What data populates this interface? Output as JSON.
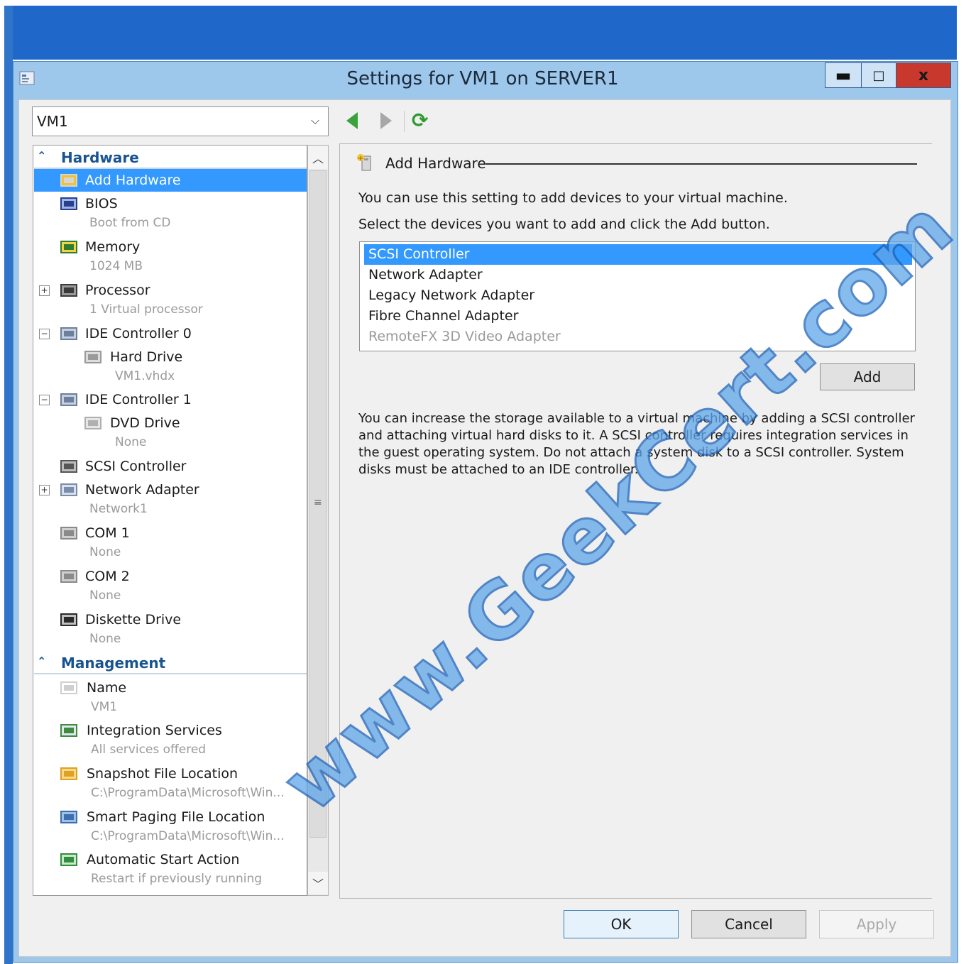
{
  "window": {
    "title": "Settings for VM1 on SERVER1",
    "minimize_glyph": "▬",
    "maximize_glyph": "□",
    "close_glyph": "x"
  },
  "vm_selector": {
    "selected": "VM1"
  },
  "tree": {
    "hardware_section": "Hardware",
    "management_section": "Management",
    "items": [
      {
        "label": "Add Hardware",
        "sub": "",
        "icon": "add-hardware-icon"
      },
      {
        "label": "BIOS",
        "sub": "Boot from CD",
        "icon": "bios-icon"
      },
      {
        "label": "Memory",
        "sub": "1024 MB",
        "icon": "memory-icon"
      },
      {
        "label": "Processor",
        "sub": "1 Virtual processor",
        "icon": "processor-icon"
      },
      {
        "label": "IDE Controller 0",
        "sub": "",
        "icon": "ide-controller-icon"
      },
      {
        "label": "Hard Drive",
        "sub": "VM1.vhdx",
        "icon": "hard-drive-icon"
      },
      {
        "label": "IDE Controller 1",
        "sub": "",
        "icon": "ide-controller-icon"
      },
      {
        "label": "DVD Drive",
        "sub": "None",
        "icon": "dvd-drive-icon"
      },
      {
        "label": "SCSI Controller",
        "sub": "",
        "icon": "scsi-controller-icon"
      },
      {
        "label": "Network Adapter",
        "sub": "Network1",
        "icon": "network-adapter-icon"
      },
      {
        "label": "COM 1",
        "sub": "None",
        "icon": "com-port-icon"
      },
      {
        "label": "COM 2",
        "sub": "None",
        "icon": "com-port-icon"
      },
      {
        "label": "Diskette Drive",
        "sub": "None",
        "icon": "diskette-drive-icon"
      }
    ],
    "mgmt_items": [
      {
        "label": "Name",
        "sub": "VM1",
        "icon": "name-icon"
      },
      {
        "label": "Integration Services",
        "sub": "All services offered",
        "icon": "integration-services-icon"
      },
      {
        "label": "Snapshot File Location",
        "sub": "C:\\ProgramData\\Microsoft\\Win...",
        "icon": "snapshot-icon"
      },
      {
        "label": "Smart Paging File Location",
        "sub": "C:\\ProgramData\\Microsoft\\Win...",
        "icon": "smart-paging-icon"
      },
      {
        "label": "Automatic Start Action",
        "sub": "Restart if previously running",
        "icon": "auto-start-icon"
      }
    ]
  },
  "content": {
    "title": "Add Hardware",
    "description": "You can use this setting to add devices to your virtual machine.",
    "instruction": "Select the devices you want to add and click the Add button.",
    "devices": [
      "SCSI Controller",
      "Network Adapter",
      "Legacy Network Adapter",
      "Fibre Channel Adapter",
      "RemoteFX 3D Video Adapter"
    ],
    "add_label": "Add",
    "info": "You can increase the storage available to a virtual machine by adding a SCSI controller and attaching virtual hard disks to it. A SCSI controller requires integration services in the guest operating system. Do not attach a system disk to a SCSI controller. System disks must be attached to an IDE controller."
  },
  "buttons": {
    "ok": "OK",
    "cancel": "Cancel",
    "apply": "Apply"
  },
  "watermark": "www.GeekCert.com",
  "colors": {
    "selection": "#3399ff",
    "title_band": "#1f67c9",
    "close": "#c8382c"
  }
}
